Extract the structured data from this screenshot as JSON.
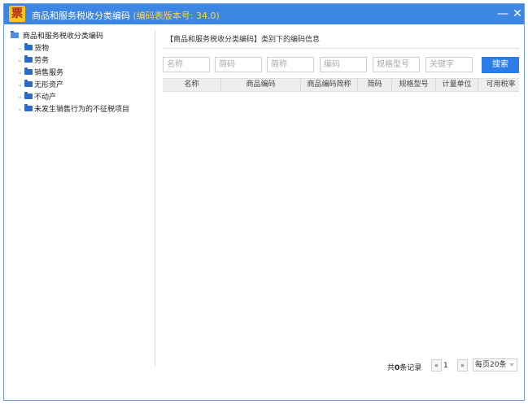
{
  "window": {
    "title": "商品和服务税收分类编码",
    "version_text": "(编码表版本号: 34.0)",
    "app_icon_char": "票",
    "minimize_symbol": "—",
    "close_symbol": "✕"
  },
  "tree": {
    "root_label": "商品和服务税收分类编码",
    "items": [
      {
        "label": "货物"
      },
      {
        "label": "劳务"
      },
      {
        "label": "销售服务"
      },
      {
        "label": "无形资产"
      },
      {
        "label": "不动产"
      },
      {
        "label": "未发生销售行为的不征税项目"
      }
    ],
    "expand_symbol": "⌄"
  },
  "content": {
    "info_title": "【商品和服务税收分类编码】类别下的编码信息",
    "search": {
      "name_placeholder": "名称",
      "short_code_placeholder": "简码",
      "abbr_placeholder": "简称",
      "code_placeholder": "编码",
      "spec_placeholder": "规格型号",
      "keyword_placeholder": "关键字",
      "search_button": "搜索"
    },
    "table": {
      "columns": [
        "名称",
        "商品编码",
        "商品编码简称",
        "简码",
        "规格型号",
        "计量单位",
        "可用税率"
      ],
      "rows": []
    },
    "pager": {
      "total_prefix": "共",
      "total_count": "0",
      "total_suffix": "条记录",
      "prev_symbol": "«",
      "current_page": "1",
      "next_symbol": "»",
      "page_size_label": "每页20条"
    }
  },
  "colors": {
    "titlebar": "#3d86e3",
    "version_text": "#ffd34d",
    "search_button": "#2b7de9",
    "folder_icon": "#2a6ac8"
  }
}
